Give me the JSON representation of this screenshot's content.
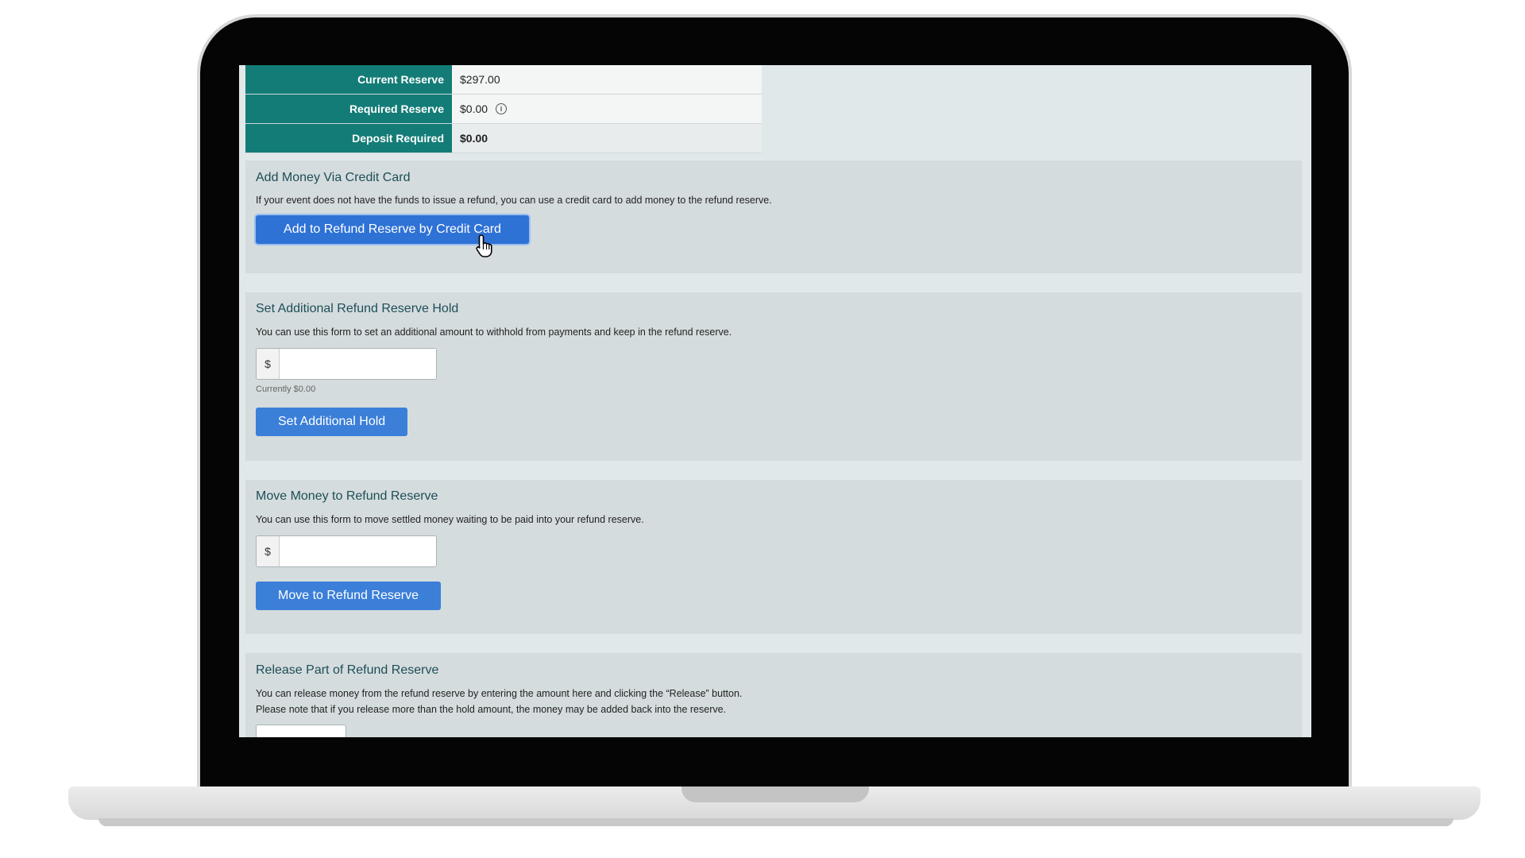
{
  "summary": {
    "rows": [
      {
        "label": "Current Reserve",
        "value": "$297.00"
      },
      {
        "label": "Required Reserve",
        "value": "$0.00"
      },
      {
        "label": "Deposit Required",
        "value": "$0.00"
      }
    ]
  },
  "credit_card": {
    "title": "Add Money Via Credit Card",
    "description": "If your event does not have the funds to issue a refund, you can use a credit card to add money to the refund reserve.",
    "button": "Add to Refund Reserve by Credit Card"
  },
  "additional_hold": {
    "title": "Set Additional Refund Reserve Hold",
    "description": "You can use this form to set an additional amount to withhold from payments and keep in the refund reserve.",
    "currency_prefix": "$",
    "value": "",
    "hint": "Currently $0.00",
    "button": "Set Additional Hold"
  },
  "move_money": {
    "title": "Move Money to Refund Reserve",
    "description": "You can use this form to move settled money waiting to be paid into your refund reserve.",
    "currency_prefix": "$",
    "value": "",
    "button": "Move to Refund Reserve"
  },
  "release": {
    "title": "Release Part of Refund Reserve",
    "description_line1": "You can release money from the refund reserve by entering the amount here and clicking the “Release” button.",
    "description_line2": "Please note that if you release more than the hold amount, the money may be added back into the reserve."
  },
  "colors": {
    "table_header": "#137c77",
    "button": "#3b7fd9",
    "panel": "#d5dcde",
    "screen_bg": "#e1e8ea"
  },
  "icons": [
    "info-icon",
    "hand-pointer-cursor-icon"
  ]
}
